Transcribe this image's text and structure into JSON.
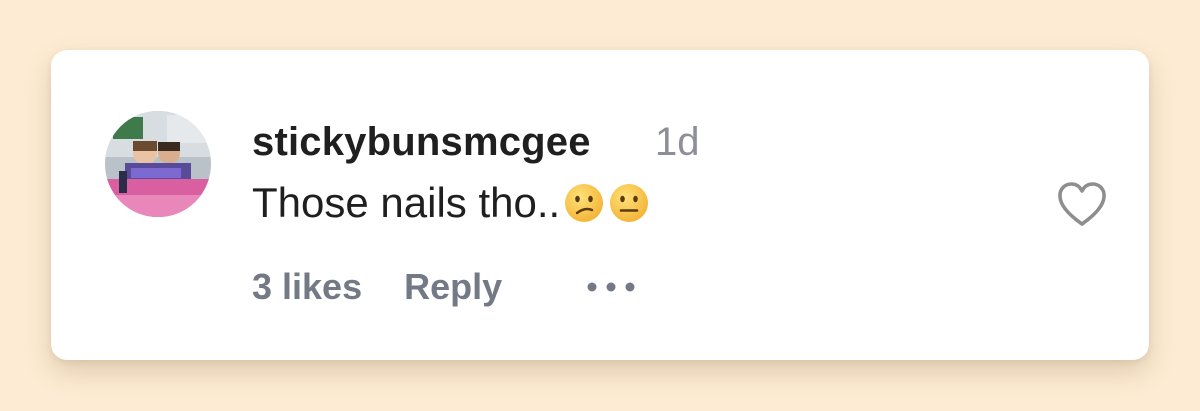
{
  "comment": {
    "username": "stickybunsmcgee",
    "time_ago": "1d",
    "text": "Those nails tho..",
    "emojis": [
      "confused-face-icon",
      "neutral-face-icon"
    ],
    "likes_label": "3 likes",
    "reply_label": "Reply",
    "more_icon": "more-options-icon",
    "like_icon": "heart-outline-icon"
  },
  "colors": {
    "background": "#fdebd3",
    "card": "#ffffff",
    "primary_text": "#1f1f1f",
    "secondary_text": "#737985",
    "timestamp": "#8e8e99"
  }
}
